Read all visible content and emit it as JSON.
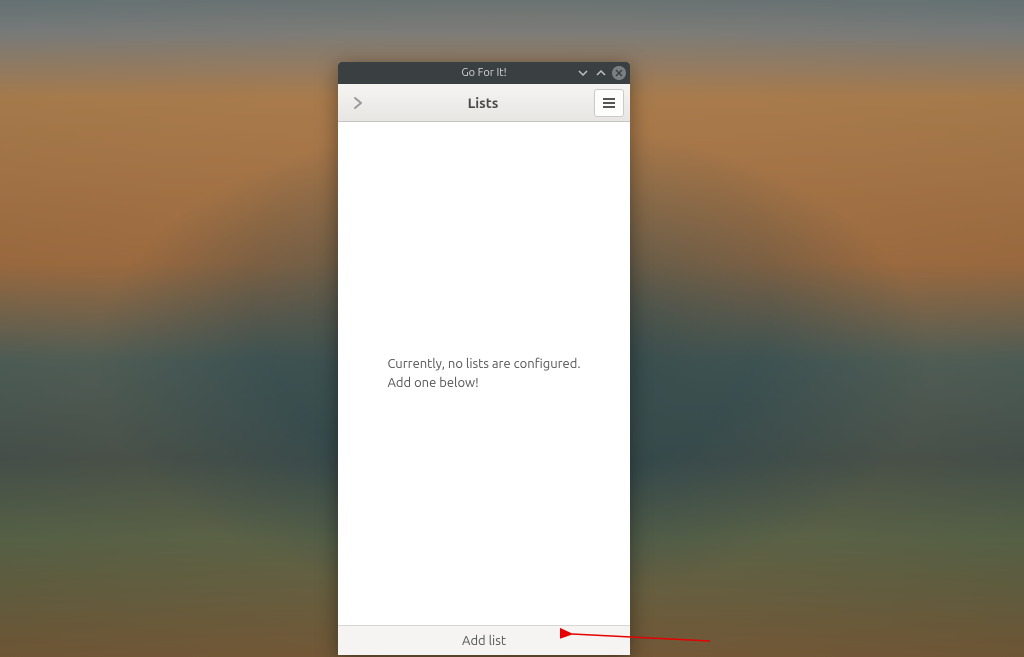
{
  "window": {
    "title": "Go For It!"
  },
  "header": {
    "title": "Lists"
  },
  "content": {
    "empty_line1": "Currently, no lists are configured.",
    "empty_line2": "Add one below!"
  },
  "footer": {
    "add_label": "Add list"
  }
}
